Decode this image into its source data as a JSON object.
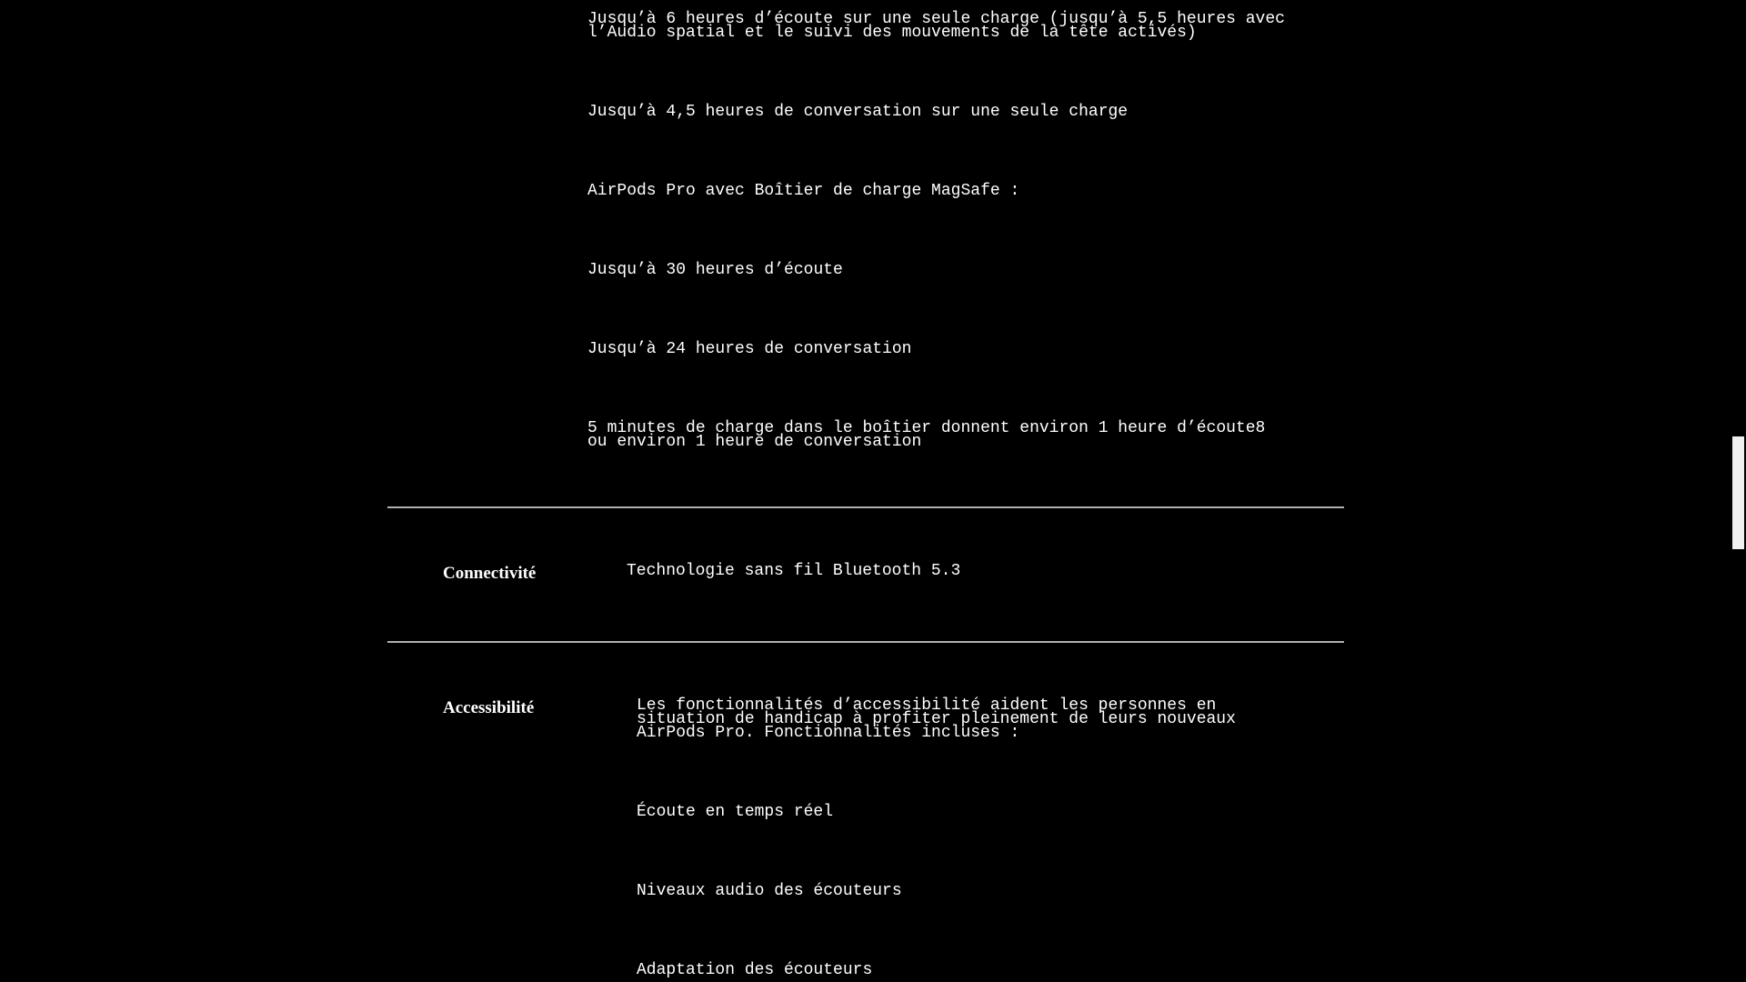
{
  "battery": {
    "line1a": "Jusqu’à 6 heures d’écoute sur une seule charge (jusqu’à 5,5 heures avec",
    "line1b": "l’Audio spatial et le suivi des mouvements de la tête activés)",
    "line2": "Jusqu’à 4,5 heures de conversation sur une seule charge",
    "line3": "AirPods Pro avec Boîtier de charge MagSafe :",
    "line4": "Jusqu’à 30 heures d’écoute",
    "line5": "Jusqu’à 24 heures de conversation",
    "line6a": "5 minutes de charge dans le boîtier donnent environ 1 heure d’écoute8",
    "line6b": "ou environ 1 heure de conversation"
  },
  "connectivity": {
    "label": "Connectivité",
    "value": "Technologie sans fil Bluetooth 5.3"
  },
  "accessibility": {
    "label": "Accessibilité",
    "intro_a": "Les fonctionnalités d’accessibilité aident les personnes en",
    "intro_b": "situation de handicap à profiter pleinement de leurs nouveaux",
    "intro_c": "AirPods Pro. Fonctionnalités incluses :",
    "features": [
      "Écoute en temps réel",
      "Niveaux audio des écouteurs",
      "Adaptation des écouteurs"
    ]
  }
}
